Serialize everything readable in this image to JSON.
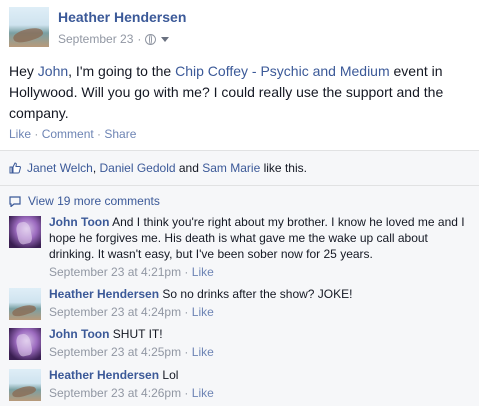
{
  "post": {
    "author": "Heather Hendersen",
    "date": "September 23",
    "meta_sep": "·",
    "text_1": "Hey ",
    "tag_1": "John",
    "text_2": ", I'm going to the ",
    "tag_2": "Chip Coffey - Psychic and Medium",
    "text_3": " event in Hollywood. Will you go with me? I could really use the support and the company.",
    "actions": {
      "like": "Like",
      "comment": "Comment",
      "share": "Share",
      "sep": " · "
    }
  },
  "likes": {
    "names": [
      "Janet Welch",
      "Daniel Gedold",
      "Sam Marie"
    ],
    "sep": ", ",
    "and": " and ",
    "suffix": " like this."
  },
  "view_more": "View 19 more comments",
  "comments": [
    {
      "author": "John Toon",
      "text": "And I think you're right about my brother. I know he loved me and I hope he forgives me. His death is what gave me the wake up call about drinking. It wasn't easy, but I've been sober now for 25 years.",
      "time": "September 23 at 4:21pm",
      "like": "Like"
    },
    {
      "author": "Heather Hendersen",
      "text": "So no drinks after the show? JOKE!",
      "time": "September 23 at 4:24pm",
      "like": "Like"
    },
    {
      "author": "John Toon",
      "text": "SHUT IT!",
      "time": "September 23 at 4:25pm",
      "like": "Like"
    },
    {
      "author": "Heather Hendersen",
      "text": "Lol",
      "time": "September 23 at 4:26pm",
      "like": "Like"
    }
  ],
  "meta_sep": " · ",
  "colors": {
    "link": "#3b5998",
    "muted": "#9197a3",
    "action": "#6d84b4",
    "feedback_bg": "#f6f7f9"
  }
}
